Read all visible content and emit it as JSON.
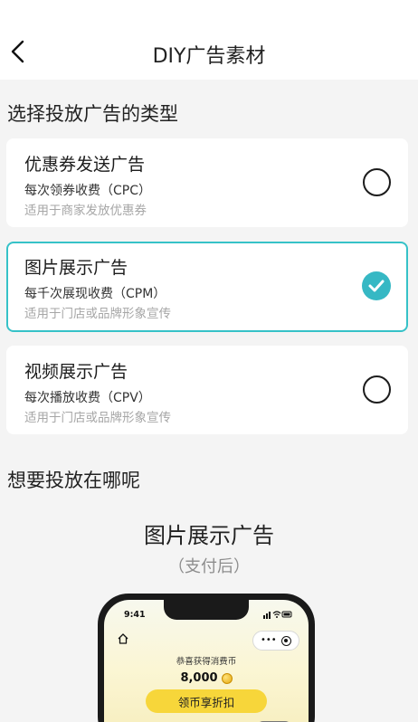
{
  "header": {
    "title": "DIY广告素材",
    "back_icon": "chevron-left-icon"
  },
  "section_type": {
    "title": "选择投放广告的类型"
  },
  "options": [
    {
      "title": "优惠券发送广告",
      "price": "每次领券收费（CPC）",
      "desc": "适用于商家发放优惠券",
      "selected": false
    },
    {
      "title": "图片展示广告",
      "price": "每千次展现收费（CPM）",
      "desc": "适用于门店或品牌形象宣传",
      "selected": true
    },
    {
      "title": "视频展示广告",
      "price": "每次播放收费（CPV）",
      "desc": "适用于门店或品牌形象宣传",
      "selected": false
    }
  ],
  "section_where": {
    "title": "想要投放在哪呢"
  },
  "preview": {
    "title": "图片展示广告",
    "subtitle": "（支付后）",
    "phone": {
      "time": "9:41",
      "capsule_dots": "•••",
      "congrats_text": "恭喜获得消费币",
      "amount": "8,000",
      "redeem_button": "领币享折扣"
    }
  },
  "colors": {
    "accent": "#36b8c4",
    "selected_border": "#36c2c8",
    "button_yellow": "#f7d63a",
    "background": "#f4f4f4"
  }
}
